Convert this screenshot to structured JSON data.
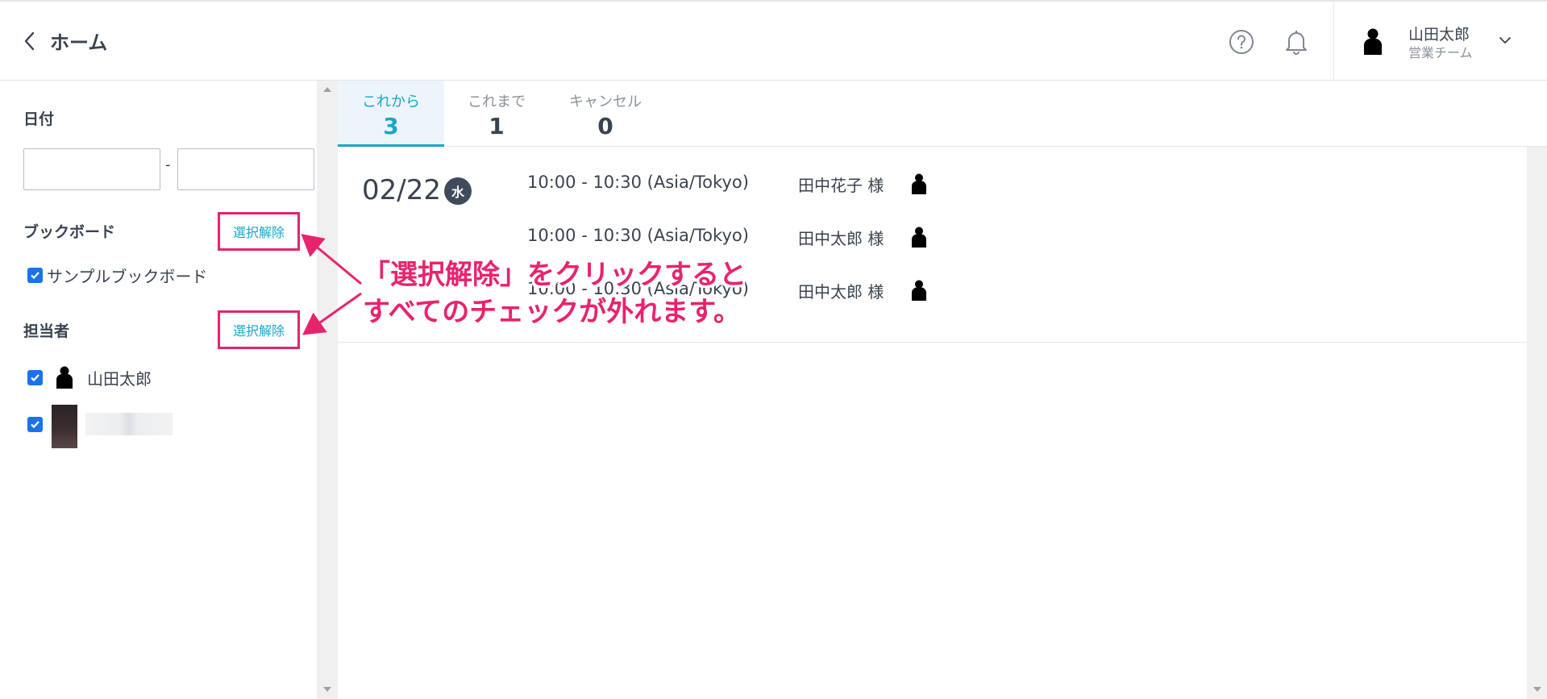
{
  "header": {
    "title": "ホーム",
    "user_name": "山田太郎",
    "user_team": "営業チーム"
  },
  "sidebar": {
    "date_label": "日付",
    "date_from": "",
    "date_to": "",
    "date_separator": "-",
    "bookboard_label": "ブックボード",
    "bookboard_clear": "選択解除",
    "bookboards": [
      {
        "label": "サンプルブックボード",
        "checked": true
      }
    ],
    "assignee_label": "担当者",
    "assignee_clear": "選択解除",
    "assignees": [
      {
        "label": "山田太郎",
        "checked": true
      },
      {
        "label": "",
        "checked": true
      }
    ]
  },
  "tabs": [
    {
      "label": "これから",
      "count": "3",
      "active": true
    },
    {
      "label": "これまで",
      "count": "1",
      "active": false
    },
    {
      "label": "キャンセル",
      "count": "0",
      "active": false
    }
  ],
  "schedule": {
    "date": "02/22",
    "weekday": "水",
    "rows": [
      {
        "time": "10:00 - 10:30 (Asia/Tokyo)",
        "guest": "田中花子 様"
      },
      {
        "time": "10:00 - 10:30 (Asia/Tokyo)",
        "guest": "田中太郎 様"
      },
      {
        "time": "10:00 - 10:30 (Asia/Tokyo)",
        "guest": "田中太郎 様"
      }
    ]
  },
  "annotation": {
    "line1": "「選択解除」をクリックすると",
    "line2": "すべてのチェックが外れます。",
    "color": "#e8236e"
  },
  "colors": {
    "accent": "#19a6c8",
    "checkbox": "#1a73e8",
    "text": "#3a4250",
    "badge": "#3e4b5b"
  }
}
